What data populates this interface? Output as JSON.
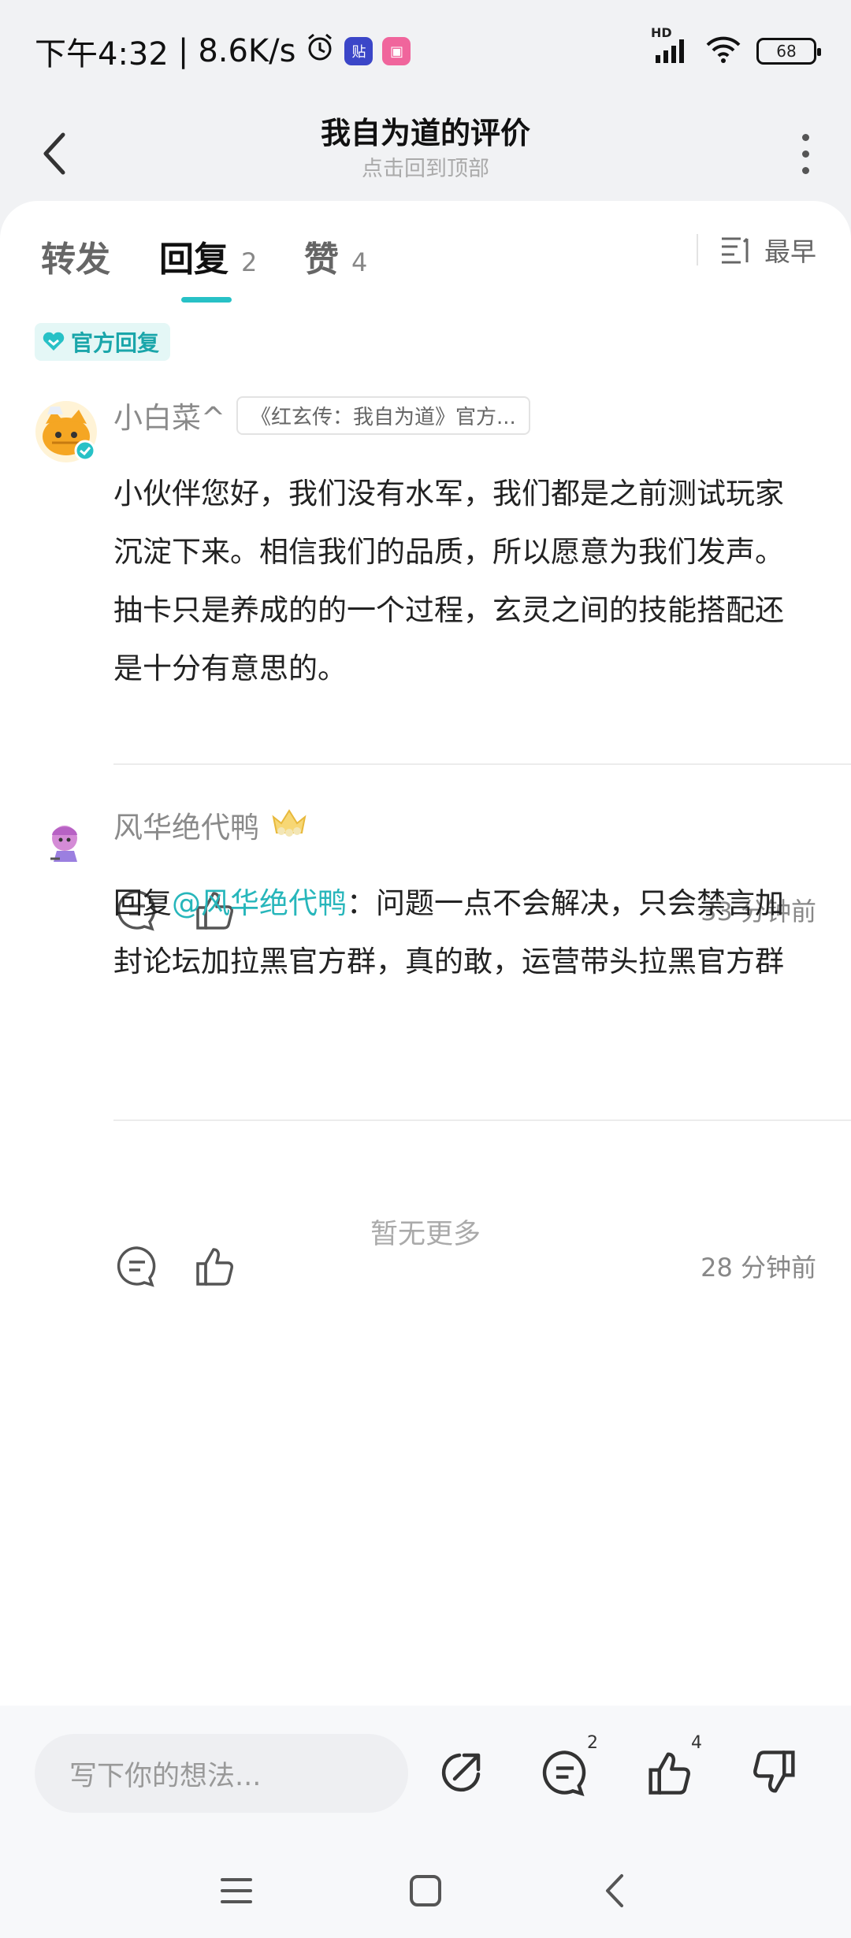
{
  "status_bar": {
    "time": "下午4:32",
    "speed": "8.6K/s",
    "battery": "68",
    "network_label": "HD"
  },
  "header": {
    "title": "我自为道的评价",
    "subtitle": "点击回到顶部"
  },
  "tabs": [
    {
      "label": "转发",
      "count": ""
    },
    {
      "label": "回复",
      "count": "2"
    },
    {
      "label": "赞",
      "count": "4"
    }
  ],
  "sort_label": "最早",
  "official_badge": "官方回复",
  "comments": [
    {
      "author": "小白菜^",
      "tag": "《红玄传：我自为道》官方...",
      "text": "小伙伴您好，我们没有水军，我们都是之前测试玩家沉淀下来。相信我们的品质，所以愿意为我们发声。抽卡只是养成的的一个过程，玄灵之间的技能搭配还是十分有意思的。",
      "time": "33 分钟前"
    },
    {
      "author": "风华绝代鸭",
      "reply_prefix": "回复",
      "mention": "@风华绝代鸭",
      "text": "：问题一点不会解决，只会禁言加封论坛加拉黑官方群，真的敢，运营带头拉黑官方群",
      "time": "28 分钟前"
    }
  ],
  "no_more": "暂无更多",
  "bottom_bar": {
    "input_placeholder": "写下你的想法...",
    "comment_count": "2",
    "like_count": "4"
  },
  "colors": {
    "accent": "#27c1c6",
    "background": "#f1f2f4"
  }
}
